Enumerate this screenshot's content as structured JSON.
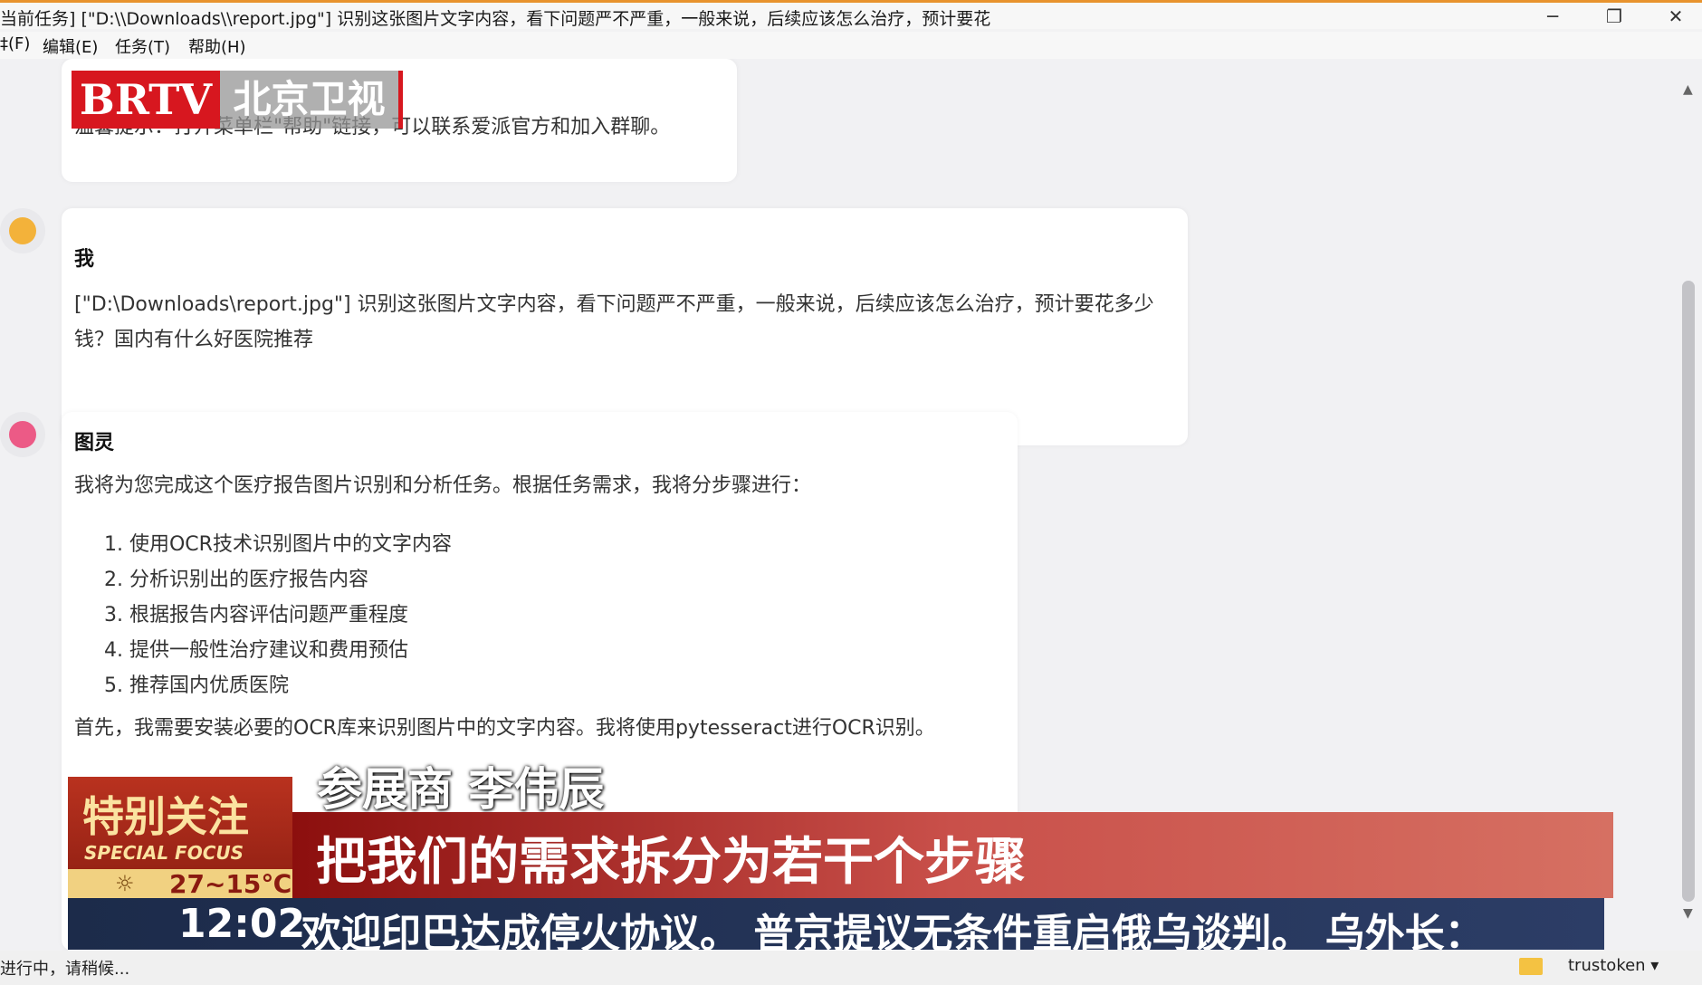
{
  "window": {
    "title": "当前任务] [\"D:\\\\Downloads\\\\report.jpg\"] 识别这张图片文字内容，看下问题严不严重，一般来说，后续应该怎么治疗，预计要花",
    "minimize_glyph": "─",
    "maximize_glyph": "❐",
    "close_glyph": "✕"
  },
  "menu": {
    "items": [
      "‡(F)",
      "编辑(E)",
      "任务(T)",
      "帮助(H)"
    ]
  },
  "chat": {
    "prev_message_tail": "温馨提示：打开菜单栏\"帮助\"链接，可以联系爱派官方和加入群聊。",
    "user": {
      "name": "我",
      "text": "[\"D:\\Downloads\\report.jpg\"] 识别这张图片文字内容，看下问题严不严重，一般来说，后续应该怎么治疗，预计要花多少钱？国内有什么好医院推荐"
    },
    "assistant": {
      "name": "图灵",
      "intro": "我将为您完成这个医疗报告图片识别和分析任务。根据任务需求，我将分步骤进行：",
      "steps": [
        "1. 使用OCR技术识别图片中的文字内容",
        "2. 分析识别出的医疗报告内容",
        "3. 根据报告内容评估问题严重程度",
        "4. 提供一般性治疗建议和费用预估",
        "5. 推荐国内优质医院"
      ],
      "outro": "首先，我需要安装必要的OCR库来识别图片中的文字内容。我将使用pytesseract进行OCR识别。"
    }
  },
  "status": {
    "text": "进行中，请稍候...",
    "user": "trustoken ▾"
  },
  "scrollbar": {
    "up_glyph": "▲",
    "down_glyph": "▼"
  },
  "overlay": {
    "logo_left": "BRTV",
    "logo_right": "北京卫视",
    "caption_name": "参展商 李伟辰",
    "banner_title": "特别关注",
    "banner_sub": "SPECIAL FOCUS",
    "weather_icon": "☼",
    "weather_temp": "27~15℃",
    "headline": "把我们的需求拆分为若干个步骤",
    "ticker_time": "12:02",
    "ticker_text": "欢迎印巴达成停火协议。  普京提议无条件重启俄乌谈判。  乌外长："
  },
  "colors": {
    "brtv_red": "#d7171f",
    "title_accent": "#e8932e"
  }
}
